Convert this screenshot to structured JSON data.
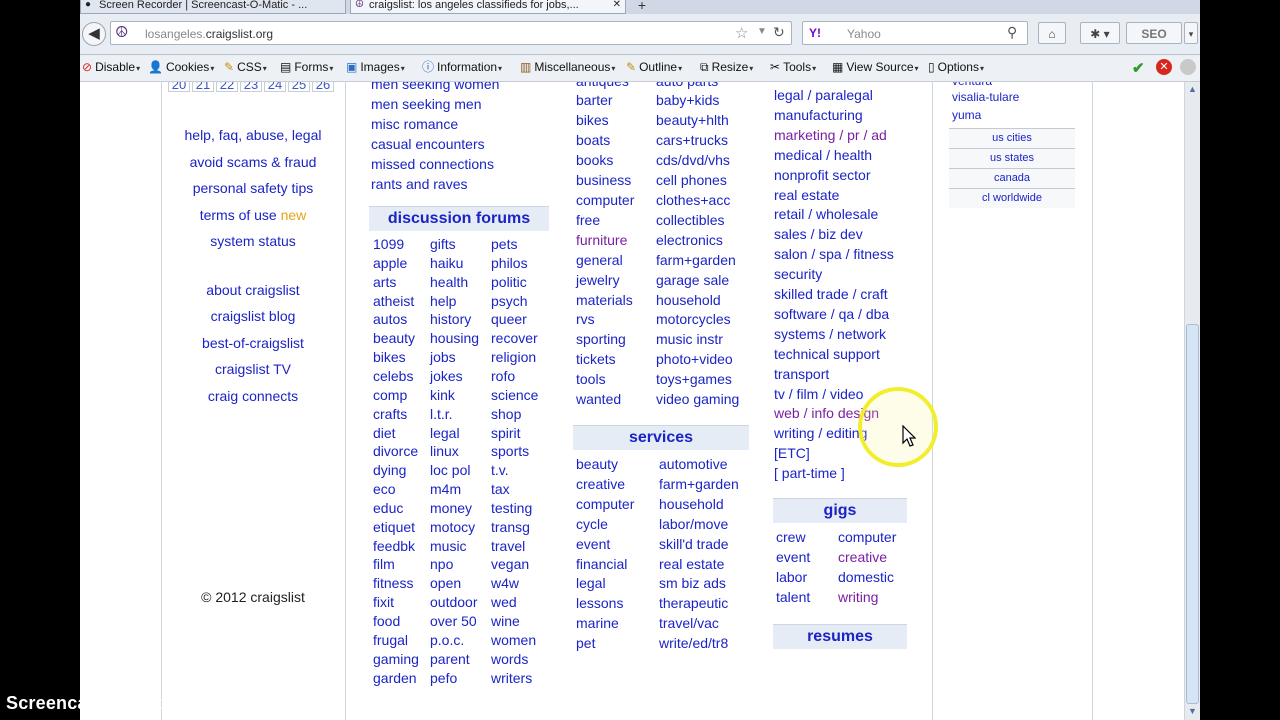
{
  "tabs": [
    {
      "title": "Screen Recorder | Screencast-O-Matic - ..."
    },
    {
      "title": "craigslist: los angeles classifieds for jobs,..."
    }
  ],
  "newtab_label": "+",
  "address": {
    "url_host_prefix": "losangeles.",
    "url_host_main": "craigslist.org"
  },
  "search": {
    "engine": "Y!",
    "placeholder": "Yahoo"
  },
  "toolbar": {
    "seo_label": "SEO"
  },
  "devbar": {
    "items": [
      "Disable",
      "Cookies",
      "CSS",
      "Forms",
      "Images",
      "Information",
      "Miscellaneous",
      "Outline",
      "Resize",
      "Tools",
      "View Source",
      "Options"
    ]
  },
  "calendar": {
    "days": [
      "20",
      "21",
      "22",
      "23",
      "24",
      "25",
      "26"
    ]
  },
  "left_links": [
    "help, faq, abuse, legal",
    "avoid scams & fraud",
    "personal safety tips",
    "terms of use",
    "system status",
    "about craigslist",
    "craigslist blog",
    "best-of-craigslist",
    "craigslist TV",
    "craig connects"
  ],
  "terms_new": "new",
  "copyright": "© 2012 craigslist",
  "personals": [
    "men seeking women",
    "men seeking men",
    "misc romance",
    "casual encounters",
    "missed connections",
    "rants and raves"
  ],
  "forums": {
    "title": "discussion forums",
    "col1": [
      "1099",
      "apple",
      "arts",
      "atheist",
      "autos",
      "beauty",
      "bikes",
      "celebs",
      "comp",
      "crafts",
      "diet",
      "divorce",
      "dying",
      "eco",
      "educ",
      "etiquet",
      "feedbk",
      "film",
      "fitness",
      "fixit",
      "food",
      "frugal",
      "gaming",
      "garden"
    ],
    "col2": [
      "gifts",
      "haiku",
      "health",
      "help",
      "history",
      "housing",
      "jobs",
      "jokes",
      "kink",
      "l.t.r.",
      "legal",
      "linux",
      "loc pol",
      "m4m",
      "money",
      "motocy",
      "music",
      "npo",
      "open",
      "outdoor",
      "over 50",
      "p.o.c.",
      "parent",
      "pefo"
    ],
    "col3": [
      "pets",
      "philos",
      "politic",
      "psych",
      "queer",
      "recover",
      "religion",
      "rofo",
      "science",
      "shop",
      "spirit",
      "sports",
      "t.v.",
      "tax",
      "testing",
      "transg",
      "travel",
      "vegan",
      "w4w",
      "wed",
      "wine",
      "women",
      "words",
      "writers"
    ]
  },
  "for_sale": {
    "top_partial_left": "antiques",
    "top_partial_right": "auto parts",
    "col1": [
      "barter",
      "bikes",
      "boats",
      "books",
      "business",
      "computer",
      "free",
      "furniture",
      "general",
      "jewelry",
      "materials",
      "rvs",
      "sporting",
      "tickets",
      "tools",
      "wanted"
    ],
    "col2": [
      "baby+kids",
      "beauty+hlth",
      "cars+trucks",
      "cds/dvd/vhs",
      "cell phones",
      "clothes+acc",
      "collectibles",
      "electronics",
      "farm+garden",
      "garage sale",
      "household",
      "motorcycles",
      "music instr",
      "photo+video",
      "toys+games",
      "video gaming"
    ]
  },
  "services": {
    "title": "services",
    "col1": [
      "beauty",
      "creative",
      "computer",
      "cycle",
      "event",
      "financial",
      "legal",
      "lessons",
      "marine",
      "pet"
    ],
    "col2": [
      "automotive",
      "farm+garden",
      "household",
      "labor/move",
      "skill'd trade",
      "real estate",
      "sm biz ads",
      "therapeutic",
      "travel/vac",
      "write/ed/tr8"
    ]
  },
  "jobs": [
    "legal / paralegal",
    "manufacturing",
    "marketing / pr / ad",
    "medical / health",
    "nonprofit sector",
    "real estate",
    "retail / wholesale",
    "sales / biz dev",
    "salon / spa / fitness",
    "security",
    "skilled trade / craft",
    "software / qa / dba",
    "systems / network",
    "technical support",
    "transport",
    "tv / film / video",
    "web / info design",
    "writing / editing",
    "[ETC]",
    "[ part-time ]"
  ],
  "gigs": {
    "title": "gigs",
    "col1": [
      "crew",
      "event",
      "labor",
      "talent"
    ],
    "col2": [
      "computer",
      "creative",
      "domestic",
      "writing"
    ]
  },
  "resumes": "resumes",
  "nearby": {
    "partial_top": "ventura",
    "items": [
      "visalia-tulare",
      "yuma"
    ],
    "boxes": [
      "us cities",
      "us states",
      "canada",
      "cl worldwide"
    ]
  },
  "watermark": "Screencast-O-Matic.com"
}
